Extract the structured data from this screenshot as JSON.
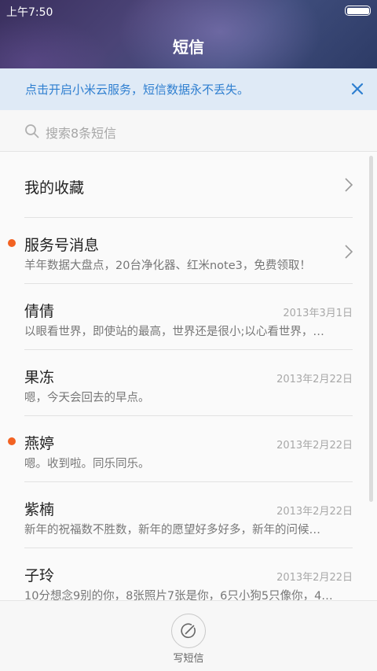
{
  "status_bar": {
    "time": "上午7:50"
  },
  "header": {
    "title": "短信"
  },
  "banner": {
    "text": "点击开启小米云服务，短信数据永不丢失。"
  },
  "search": {
    "placeholder": "搜索8条短信"
  },
  "conversations": [
    {
      "name": "我的收藏",
      "preview": "",
      "date": "",
      "unread": false,
      "has_chevron": true
    },
    {
      "name": "服务号消息",
      "preview": "羊年数据大盘点，20台净化器、红米note3，免费领取！",
      "date": "",
      "unread": true,
      "has_chevron": true
    },
    {
      "name": "倩倩",
      "preview": "以眼看世界，即使站的最高，世界还是很小;以心看世界，…",
      "date": "2013年3月1日",
      "unread": false,
      "has_chevron": false
    },
    {
      "name": "果冻",
      "preview": "嗯，今天会回去的早点。",
      "date": "2013年2月22日",
      "unread": false,
      "has_chevron": false
    },
    {
      "name": "燕婷",
      "preview": "嗯。收到啦。同乐同乐。",
      "date": "2013年2月22日",
      "unread": true,
      "has_chevron": false
    },
    {
      "name": "紫楠",
      "preview": "新年的祝福数不胜数，新年的愿望好多好多，新年的问候…",
      "date": "2013年2月22日",
      "unread": false,
      "has_chevron": false
    },
    {
      "name": "子玲",
      "preview": "10分想念9别的你，8张照片7张是你，6只小狗5只像你，4…",
      "date": "2013年2月22日",
      "unread": false,
      "has_chevron": false
    }
  ],
  "bottom_bar": {
    "compose_label": "写短信"
  },
  "colors": {
    "accent": "#2f7fd0",
    "unread_dot": "#f26222",
    "banner_bg": "#dfeaf6"
  }
}
